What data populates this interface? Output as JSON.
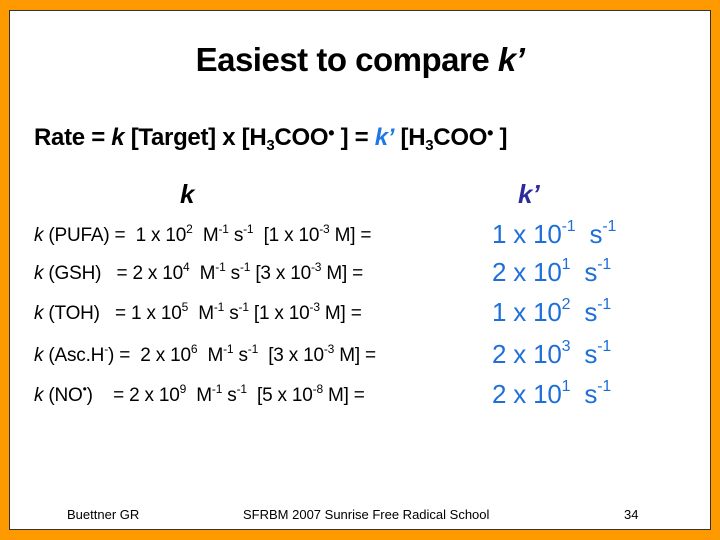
{
  "title": {
    "text": "Easiest to compare ",
    "k_symbol": "k’"
  },
  "rate_equation": {
    "prefix": "Rate = ",
    "k": "k",
    "target": " [Target] x [H",
    "sub3": "3",
    "coo": "COO",
    "dot": "•",
    "close_eq": " ] = ",
    "k_prime": "k’",
    "target2": " [H",
    "sub3b": "3",
    "coo2": "COO",
    "dot2": "•",
    "close2": " ]"
  },
  "columns": {
    "k_label": "k",
    "k_prime_label": "k’"
  },
  "rows": [
    {
      "k": "k",
      "species": " (PUFA) = ",
      "coef": " 1 x 10",
      "exp": "2",
      "units_m": "  M",
      "m_exp": "-1",
      "units_s": " s",
      "s_exp": "-1",
      "conc": "  [1 x 10",
      "conc_exp": "-3",
      "conc_end": " M] = ",
      "result": "1 x 10",
      "result_exp": "-1",
      "result_unit": "  s",
      "result_unit_exp": "-1"
    },
    {
      "k": "k",
      "species": " (GSH)   = ",
      "coef": "2 x 10",
      "exp": "4",
      "units_m": "  M",
      "m_exp": "-1",
      "units_s": " s",
      "s_exp": "-1",
      "conc": " [3 x 10",
      "conc_exp": "-3",
      "conc_end": " M] = ",
      "result": "2 x 10",
      "result_exp": "1",
      "result_unit": "  s",
      "result_unit_exp": "-1"
    },
    {
      "k": "k",
      "species": " (TOH)   = ",
      "coef": "1 x 10",
      "exp": "5",
      "units_m": "  M",
      "m_exp": "-1",
      "units_s": " s",
      "s_exp": "-1",
      "conc": " [1 x 10",
      "conc_exp": "-3",
      "conc_end": " M] = ",
      "result": "1 x 10",
      "result_exp": "2",
      "result_unit": "  s",
      "result_unit_exp": "-1"
    },
    {
      "k": "k",
      "species": " (Asc.H",
      "species_sup": "-",
      "species_end": ") = ",
      "coef": " 2 x 10",
      "exp": "6",
      "units_m": "  M",
      "m_exp": "-1",
      "units_s": " s",
      "s_exp": "-1",
      "conc": "  [3 x 10",
      "conc_exp": "-3",
      "conc_end": " M] = ",
      "result": "2 x 10",
      "result_exp": "3",
      "result_unit": "  s",
      "result_unit_exp": "-1"
    },
    {
      "k": "k",
      "species": " (NO",
      "species_sup": "•",
      "species_end": ")    = ",
      "coef": "2 x 10",
      "exp": "9",
      "units_m": "  M",
      "m_exp": "-1",
      "units_s": " s",
      "s_exp": "-1",
      "conc": "  [5 x 10",
      "conc_exp": "-8",
      "conc_end": " M] = ",
      "result": "2 x 10",
      "result_exp": "1",
      "result_unit": "  s",
      "result_unit_exp": "-1"
    }
  ],
  "footer": {
    "author": "Buettner  GR",
    "event": "SFRBM 2007   Sunrise Free Radical School",
    "page": "34"
  },
  "colors": {
    "border": "#ff9900",
    "k_prime_header": "#2b2b9e",
    "k_prime_values": "#1e6fd9",
    "k_prime_equation": "#1e78e6"
  }
}
